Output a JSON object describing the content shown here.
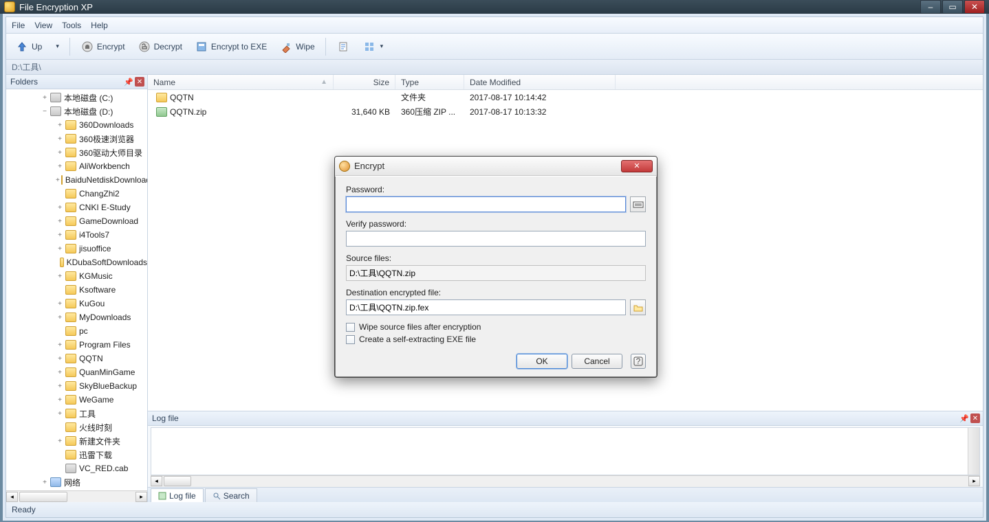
{
  "app": {
    "title": "File Encryption XP",
    "status": "Ready"
  },
  "menu": {
    "file": "File",
    "view": "View",
    "tools": "Tools",
    "help": "Help"
  },
  "toolbar": {
    "up": "Up",
    "encrypt": "Encrypt",
    "decrypt": "Decrypt",
    "encrypt_exe": "Encrypt to EXE",
    "wipe": "Wipe"
  },
  "address": "D:\\工具\\",
  "sidebar": {
    "title": "Folders",
    "items": [
      {
        "label": "本地磁盘 (C:)",
        "level": 1,
        "expand": "+",
        "icon": "drive"
      },
      {
        "label": "本地磁盘 (D:)",
        "level": 1,
        "expand": "−",
        "icon": "drive"
      },
      {
        "label": "360Downloads",
        "level": 2,
        "expand": "+",
        "icon": "folder"
      },
      {
        "label": "360极速浏览器",
        "level": 2,
        "expand": "+",
        "icon": "folder"
      },
      {
        "label": "360驱动大师目录",
        "level": 2,
        "expand": "+",
        "icon": "folder"
      },
      {
        "label": "AliWorkbench",
        "level": 2,
        "expand": "+",
        "icon": "folder"
      },
      {
        "label": "BaiduNetdiskDownload",
        "level": 2,
        "expand": "+",
        "icon": "folder"
      },
      {
        "label": "ChangZhi2",
        "level": 2,
        "expand": "",
        "icon": "folder"
      },
      {
        "label": "CNKI E-Study",
        "level": 2,
        "expand": "+",
        "icon": "folder"
      },
      {
        "label": "GameDownload",
        "level": 2,
        "expand": "+",
        "icon": "folder"
      },
      {
        "label": "i4Tools7",
        "level": 2,
        "expand": "+",
        "icon": "folder"
      },
      {
        "label": "jisuoffice",
        "level": 2,
        "expand": "+",
        "icon": "folder"
      },
      {
        "label": "KDubaSoftDownloads",
        "level": 2,
        "expand": "",
        "icon": "folder"
      },
      {
        "label": "KGMusic",
        "level": 2,
        "expand": "+",
        "icon": "folder"
      },
      {
        "label": "Ksoftware",
        "level": 2,
        "expand": "",
        "icon": "folder"
      },
      {
        "label": "KuGou",
        "level": 2,
        "expand": "+",
        "icon": "folder"
      },
      {
        "label": "MyDownloads",
        "level": 2,
        "expand": "+",
        "icon": "folder"
      },
      {
        "label": "pc",
        "level": 2,
        "expand": "",
        "icon": "folder"
      },
      {
        "label": "Program Files",
        "level": 2,
        "expand": "+",
        "icon": "folder"
      },
      {
        "label": "QQTN",
        "level": 2,
        "expand": "+",
        "icon": "folder"
      },
      {
        "label": "QuanMinGame",
        "level": 2,
        "expand": "+",
        "icon": "folder"
      },
      {
        "label": "SkyBlueBackup",
        "level": 2,
        "expand": "+",
        "icon": "folder"
      },
      {
        "label": "WeGame",
        "level": 2,
        "expand": "+",
        "icon": "folder"
      },
      {
        "label": "工具",
        "level": 2,
        "expand": "+",
        "icon": "folder"
      },
      {
        "label": "火线时刻",
        "level": 2,
        "expand": "",
        "icon": "folder"
      },
      {
        "label": "新建文件夹",
        "level": 2,
        "expand": "+",
        "icon": "folder"
      },
      {
        "label": "迅雷下载",
        "level": 2,
        "expand": "",
        "icon": "folder"
      },
      {
        "label": "VC_RED.cab",
        "level": 2,
        "expand": "",
        "icon": "drive"
      },
      {
        "label": "网络",
        "level": 1,
        "expand": "+",
        "icon": "net"
      }
    ]
  },
  "columns": {
    "name": "Name",
    "size": "Size",
    "type": "Type",
    "date": "Date Modified"
  },
  "files": [
    {
      "name": "QQTN",
      "size": "",
      "type": "文件夹",
      "date": "2017-08-17 10:14:42",
      "icon": "folder"
    },
    {
      "name": "QQTN.zip",
      "size": "31,640 KB",
      "type": "360压缩 ZIP ...",
      "date": "2017-08-17 10:13:32",
      "icon": "zip"
    }
  ],
  "log": {
    "title": "Log file",
    "tab_log": "Log file",
    "tab_search": "Search"
  },
  "dialog": {
    "title": "Encrypt",
    "password_label": "Password:",
    "verify_label": "Verify password:",
    "source_label": "Source files:",
    "source_value": "D:\\工具\\QQTN.zip",
    "dest_label": "Destination encrypted file:",
    "dest_value": "D:\\工具\\QQTN.zip.fex",
    "wipe_check": "Wipe source files after encryption",
    "exe_check": "Create a self-extracting EXE file",
    "ok": "OK",
    "cancel": "Cancel"
  }
}
